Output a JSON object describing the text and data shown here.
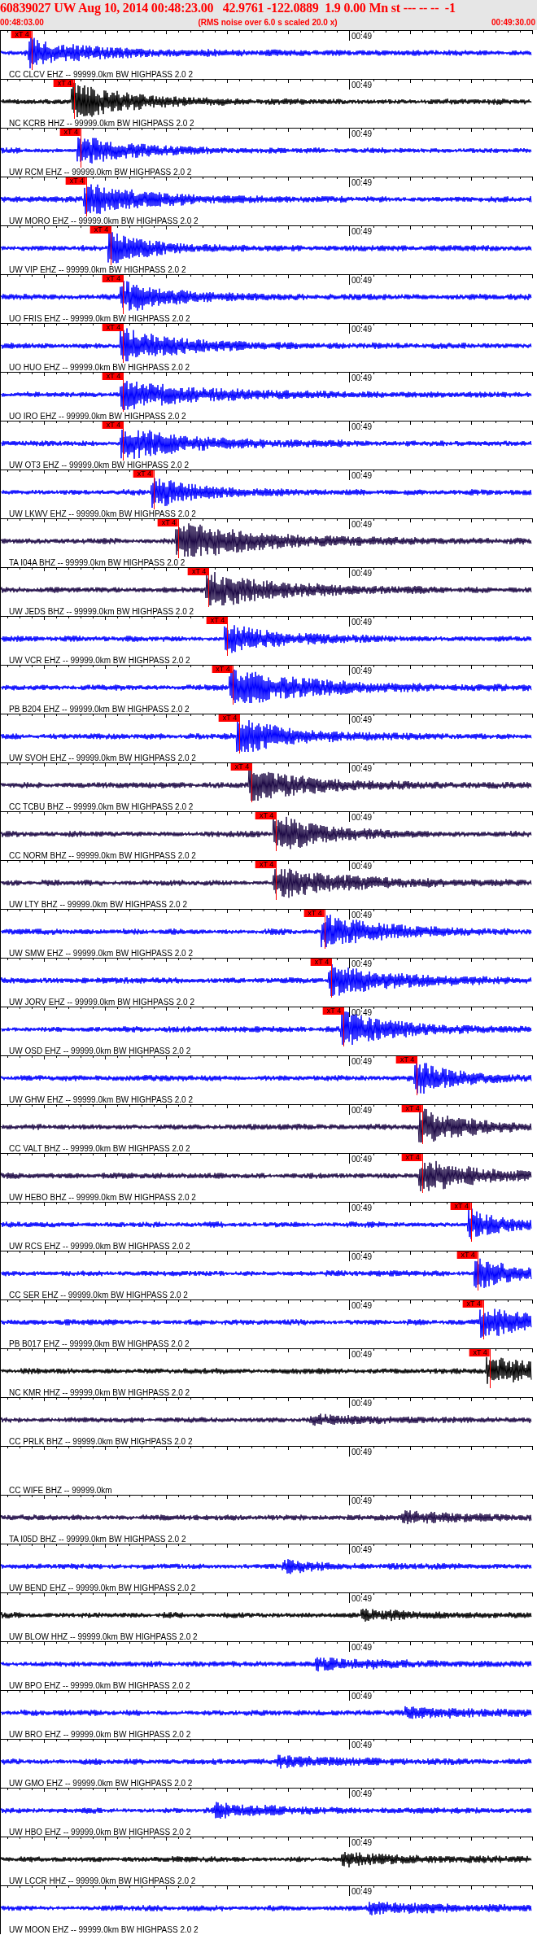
{
  "header": {
    "title": "60839027 UW Aug 10, 2014 00:48:23.00   42.9761 -122.0889  1.9 0.00 Mn st --- -- --  -1",
    "start_time": "00:48:03.00",
    "note": "(RMS noise over 6.0 s scaled 20.0 x)",
    "end_time": "00:49:30.00"
  },
  "panels": [
    {
      "station": "CC CLCV EHZ -- 99999.0km BW HIGHPASS 2.0 2",
      "time_label": "00:49",
      "color": "#0000ff",
      "pick": {
        "label": "xT 4",
        "level": 0.058
      }
    },
    {
      "station": "NC KCRB HHZ -- 99999.0km BW HIGHPASS 2.0 2",
      "time_label": "00:49",
      "color": "#000000",
      "pick": {
        "label": "xT 4",
        "level": 0.138
      }
    },
    {
      "station": "UW RCM EHZ -- 99999.0km BW HIGHPASS 2.0 2",
      "time_label": "00:49",
      "color": "#0000ff",
      "pick": {
        "label": "xT 4",
        "level": 0.15
      }
    },
    {
      "station": "UW MORO EHZ -- 99999.0km BW HIGHPASS 2.0 2",
      "time_label": "00:49",
      "color": "#0000ff",
      "pick": {
        "label": "xT 4",
        "level": 0.161
      }
    },
    {
      "station": "UW VIP EHZ -- 99999.0km BW HIGHPASS 2.0 2",
      "time_label": "00:49",
      "color": "#0000ff",
      "pick": {
        "label": "xT 4",
        "level": 0.207
      }
    },
    {
      "station": "UO FRIS EHZ -- 99999.0km BW HIGHPASS 2.0 2",
      "time_label": "00:49",
      "color": "#0000ff",
      "pick": {
        "label": "xT 4",
        "level": 0.23
      }
    },
    {
      "station": "UO HUO EHZ -- 99999.0km BW HIGHPASS 2.0 2",
      "time_label": "00:49",
      "color": "#0000ff",
      "pick": {
        "label": "xT 4",
        "level": 0.23
      }
    },
    {
      "station": "UO IRO EHZ -- 99999.0km BW HIGHPASS 2.0 2",
      "time_label": "00:49",
      "color": "#0000ff",
      "pick": {
        "label": "xT 4",
        "level": 0.23
      }
    },
    {
      "station": "UW OT3 EHZ -- 99999.0km BW HIGHPASS 2.0 2",
      "time_label": "00:49",
      "color": "#0000ff",
      "pick": {
        "label": "xT 4",
        "level": 0.23
      }
    },
    {
      "station": "UW LKWV EHZ -- 99999.0km BW HIGHPASS 2.0 2",
      "time_label": "00:49",
      "color": "#0000ff",
      "pick": {
        "label": "xT 4",
        "level": 0.288
      }
    },
    {
      "station": "TA I04A BHZ -- 99999.0km BW HIGHPASS 2.0 2",
      "time_label": "00:49",
      "color": "#1e0a46",
      "pick": {
        "label": "xT 4",
        "level": 0.334
      }
    },
    {
      "station": "UW JEDS BHZ -- 99999.0km BW HIGHPASS 2.0 2",
      "time_label": "00:49",
      "color": "#1e0a46",
      "pick": {
        "label": "xT 4",
        "level": 0.391
      }
    },
    {
      "station": "UW VCR EHZ -- 99999.0km BW HIGHPASS 2.0 2",
      "time_label": "00:49",
      "color": "#0000ff",
      "pick": {
        "label": "xT 4",
        "level": 0.426
      }
    },
    {
      "station": "PB B204 EHZ -- 99999.0km BW HIGHPASS 2.0 2",
      "time_label": "00:49",
      "color": "#0000ff",
      "pick": {
        "label": "xT 4",
        "level": 0.436
      }
    },
    {
      "station": "UW SVOH EHZ -- 99999.0km BW HIGHPASS 2.0 2",
      "time_label": "00:49",
      "color": "#0000ff",
      "pick": {
        "label": "xT 4",
        "level": 0.449
      }
    },
    {
      "station": "CC TCBU BHZ -- 99999.0km BW HIGHPASS 2.0 2",
      "time_label": "00:49",
      "color": "#1e0a46",
      "pick": {
        "label": "xT 4",
        "level": 0.472
      }
    },
    {
      "station": "CC NORM BHZ -- 99999.0km BW HIGHPASS 2.0 2",
      "time_label": "00:49",
      "color": "#1e0a46",
      "pick": {
        "label": "xT 4",
        "level": 0.518
      }
    },
    {
      "station": "UW LTY BHZ -- 99999.0km BW HIGHPASS 2.0 2",
      "time_label": "00:49",
      "color": "#1e0a46",
      "pick": {
        "label": "xT 4",
        "level": 0.518
      }
    },
    {
      "station": "UW SMW EHZ -- 99999.0km BW HIGHPASS 2.0 2",
      "time_label": "00:49",
      "color": "#0000ff",
      "pick": {
        "label": "xT 4",
        "level": 0.609
      }
    },
    {
      "station": "UW JORV EHZ -- 99999.0km BW HIGHPASS 2.0 2",
      "time_label": "00:49",
      "color": "#0000ff",
      "pick": {
        "label": "xT 4",
        "level": 0.622
      }
    },
    {
      "station": "UW OSD EHZ -- 99999.0km BW HIGHPASS 2.0 2",
      "time_label": "00:49",
      "color": "#0000ff",
      "pick": {
        "label": "xT 4",
        "level": 0.645
      }
    },
    {
      "station": "UW GHW EHZ -- 99999.0km BW HIGHPASS 2.0 2",
      "time_label": "00:49",
      "color": "#0000ff",
      "pick": {
        "label": "xT 4",
        "level": 0.783
      }
    },
    {
      "station": "CC VALT BHZ -- 99999.0km BW HIGHPASS 2.0 2",
      "time_label": "00:49",
      "color": "#1e0a46",
      "pick": {
        "label": "xT 4",
        "level": 0.793
      }
    },
    {
      "station": "UW HEBO BHZ -- 99999.0km BW HIGHPASS 2.0 2",
      "time_label": "00:49",
      "color": "#1e0a46",
      "pick": {
        "label": "xT 4",
        "level": 0.793
      }
    },
    {
      "station": "UW RCS EHZ -- 99999.0km BW HIGHPASS 2.0 2",
      "time_label": "00:49",
      "color": "#0000ff",
      "pick": {
        "label": "xT 4",
        "level": 0.885
      }
    },
    {
      "station": "CC SER EHZ -- 99999.0km BW HIGHPASS 2.0 2",
      "time_label": "00:49",
      "color": "#0000ff",
      "pick": {
        "label": "xT 4",
        "level": 0.897
      }
    },
    {
      "station": "PB B017 EHZ -- 99999.0km BW HIGHPASS 2.0 2",
      "time_label": "00:49",
      "color": "#0000ff",
      "pick": {
        "label": "xT 4",
        "level": 0.908
      }
    },
    {
      "station": "NC KMR HHZ -- 99999.0km BW HIGHPASS 2.0 2",
      "time_label": "00:49",
      "color": "#000000",
      "pick": {
        "label": "xT 4",
        "level": 0.92
      }
    },
    {
      "station": "CC PRLK BHZ -- 99999.0km BW HIGHPASS 2.0 2",
      "time_label": "00:49",
      "color": "#1e0a46"
    },
    {
      "station": "CC WIFE BHZ -- 99999.0km",
      "time_label": "00:49"
    },
    {
      "station": "TA I05D BHZ -- 99999.0km BW HIGHPASS 2.0 2",
      "time_label": "00:49",
      "color": "#1e0a46"
    },
    {
      "station": "UW BEND EHZ -- 99999.0km BW HIGHPASS 2.0 2",
      "time_label": "00:49",
      "color": "#0000ff"
    },
    {
      "station": "UW BLOW HHZ -- 99999.0km BW HIGHPASS 2.0 2",
      "time_label": "00:49",
      "color": "#000000"
    },
    {
      "station": "UW BPO EHZ -- 99999.0km BW HIGHPASS 2.0 2",
      "time_label": "00:49",
      "color": "#0000ff"
    },
    {
      "station": "UW BRO EHZ -- 99999.0km BW HIGHPASS 2.0 2",
      "time_label": "00:49",
      "color": "#0000ff"
    },
    {
      "station": "UW GMO EHZ -- 99999.0km BW HIGHPASS 2.0 2",
      "time_label": "00:49",
      "color": "#0000ff"
    },
    {
      "station": "UW HBO EHZ -- 99999.0km BW HIGHPASS 2.0 2",
      "time_label": "00:49",
      "color": "#0000ff"
    },
    {
      "station": "UW LCCR HHZ -- 99999.0km BW HIGHPASS 2.0 2",
      "time_label": "00:49",
      "color": "#000000"
    },
    {
      "station": "UW MOON EHZ -- 99999.0km BW HIGHPASS 2.0 2",
      "time_label": "00:49",
      "color": "#0000ff"
    }
  ]
}
